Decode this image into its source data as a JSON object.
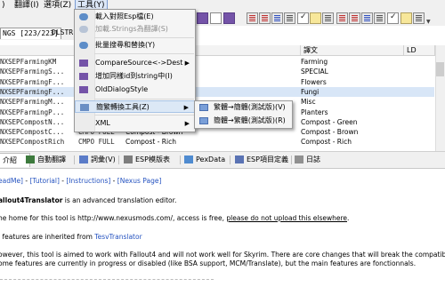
{
  "menubar": {
    "items": [
      {
        "label": ")"
      },
      {
        "label": "翻譯(I)"
      },
      {
        "label": "選項(Z)"
      },
      {
        "label": "工具(Y)"
      }
    ]
  },
  "tabs": {
    "current": "NGS [223/223]",
    "next": "DLSTR"
  },
  "grid": {
    "headers": {
      "col4": "譯文",
      "col5": "LD"
    },
    "rows": [
      {
        "id": "NXSEPFarmingKM",
        "type": "",
        "src": "",
        "trans": "Farming"
      },
      {
        "id": "NXSEPFarmingS...",
        "type": "",
        "src": "",
        "trans": "SPECIAL"
      },
      {
        "id": "NXSEPFarmingF...",
        "type": "",
        "src": "",
        "trans": "Flowers"
      },
      {
        "id": "NXSEPFarmingF...",
        "type": "",
        "src": "",
        "trans": "Fungi"
      },
      {
        "id": "NXSEPFarmingM...",
        "type": "",
        "src": "",
        "trans": "Misc"
      },
      {
        "id": "NXSEPFarmingP...",
        "type": "",
        "src": "",
        "trans": "Planters"
      },
      {
        "id": "NXSEPCompostN...",
        "type": "",
        "src": "",
        "trans": "Compost - Green"
      },
      {
        "id": "NXSEPCompostC...",
        "type": "CMPO FULL",
        "src": "Compost - Brown",
        "trans": "Compost - Brown"
      },
      {
        "id": "NXSEPCompostRich",
        "type": "CMPO FULL",
        "src": "Compost - Rich",
        "trans": "Compost - Rich"
      }
    ]
  },
  "bottom_tabs": [
    {
      "label": "介紹",
      "icon": "info-icon"
    },
    {
      "label": "自動翻譯",
      "icon": "auto-translate-icon"
    },
    {
      "label": "詞彙(V)",
      "icon": "vocabulary-icon"
    },
    {
      "label": "ESP模版表",
      "icon": "template-icon"
    },
    {
      "label": "PexData",
      "icon": "pexdata-icon"
    },
    {
      "label": "ESP項目定義",
      "icon": "definition-icon"
    },
    {
      "label": "日誌",
      "icon": "log-icon"
    }
  ],
  "content": {
    "links_line": [
      {
        "text": "eadMe]",
        "link": true
      },
      {
        "text": " - ",
        "link": false
      },
      {
        "text": "[Tutorial]",
        "link": true
      },
      {
        "text": " - ",
        "link": false
      },
      {
        "text": "[Instructions]",
        "link": true
      },
      {
        "text": " - ",
        "link": false
      },
      {
        "text": "[Nexus Page]",
        "link": true
      }
    ],
    "intro_bold": "allout4Translator",
    "intro_rest": " is an advanced translation editor.",
    "home_line": "he home for this tool is http://www.nexusmods.com/, access is free,",
    "home_warn": "please do not upload this elsewhere",
    "home_end": ".",
    "inherit_line": "l features are inherited from",
    "inherit_link": "TesvTranslator",
    "however_line": "owever, this tool is aimed to work with Fallout4 and will not work well for Skyrim. There are core changes that will break the compatibility.",
    "some_line": "ome features are currently in progress or disabled (like BSA support, MCM/Translate), but the main features are fonctionnals."
  },
  "dropdown": {
    "items": [
      {
        "label": "載入對照Esp檔(E)",
        "icon": "search-icon",
        "disabled": false
      },
      {
        "label": "加載.Strings為翻譯(S)",
        "icon": "search-disabled-icon",
        "disabled": true
      },
      {
        "label": "批量搜尋和替換(Y)",
        "icon": "search-replace-icon",
        "disabled": false
      },
      {
        "label": "CompareSource<->Dest",
        "icon": "compare-icon",
        "disabled": false,
        "submenu": true
      },
      {
        "label": "增加同樣id到string中(I)",
        "icon": "add-id-icon",
        "disabled": false
      },
      {
        "label": "OldDialogStyle",
        "icon": "dialog-style-icon",
        "disabled": false
      },
      {
        "label": "簡繁轉換工具(Z)",
        "icon": "convert-icon",
        "disabled": false,
        "submenu": true,
        "highlighted": true
      },
      {
        "label": "XML",
        "icon": "",
        "disabled": false,
        "submenu": true
      }
    ]
  },
  "submenu": {
    "items": [
      {
        "label": "繁體→簡體(測試版)(V)"
      },
      {
        "label": "簡體→繁體(測試版)(R)"
      }
    ]
  }
}
